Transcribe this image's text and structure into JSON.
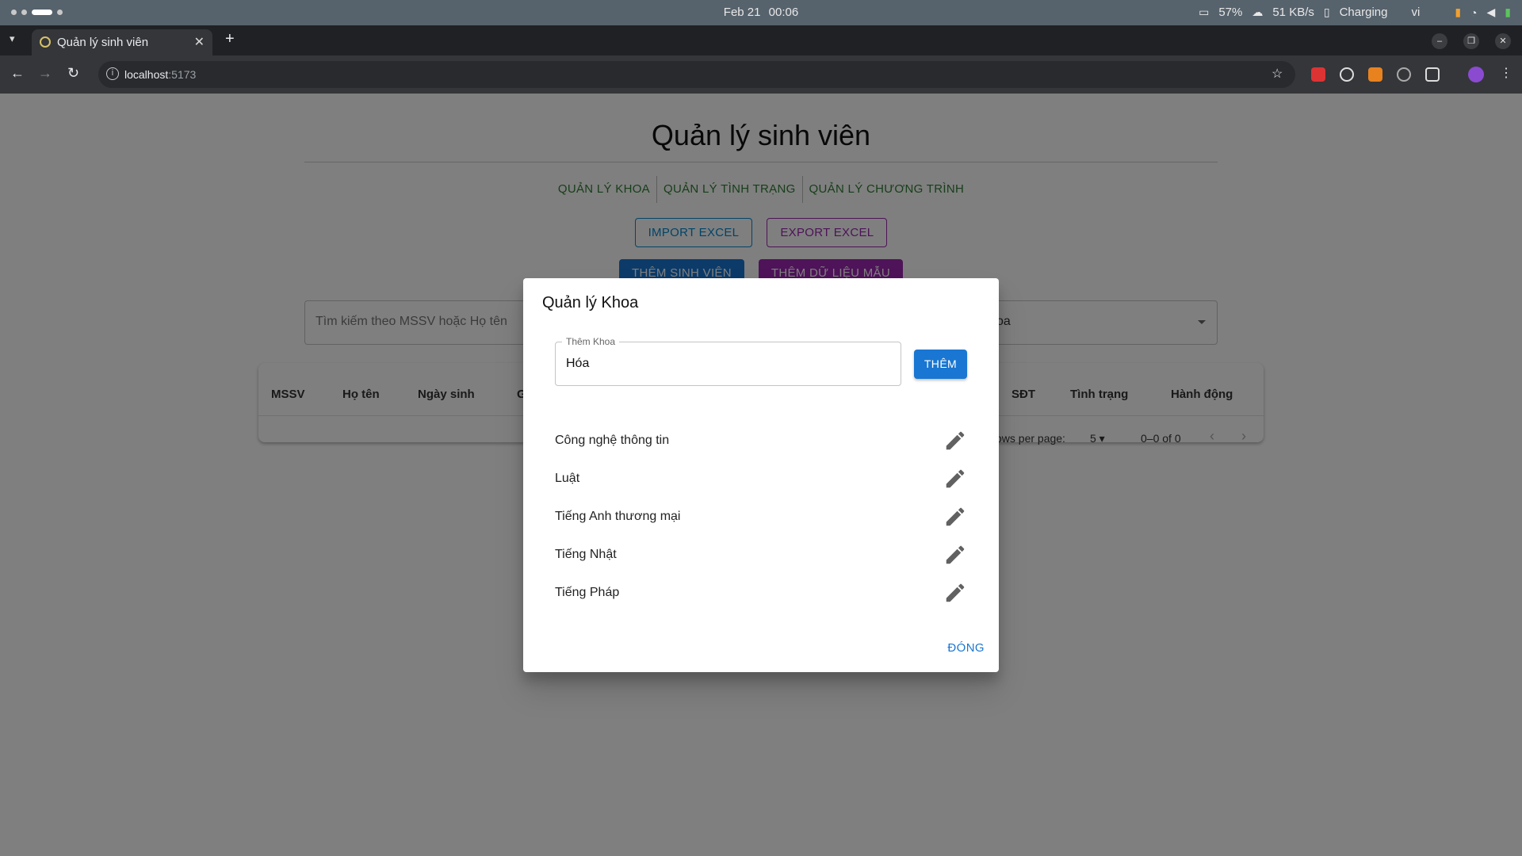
{
  "os": {
    "date": "Feb 21",
    "time": "00:06",
    "battery": "57%",
    "network_speed": "51 KB/s",
    "charging": "Charging",
    "lang": "vi"
  },
  "browser": {
    "tab_title": "Quản lý sinh viên",
    "url_host": "localhost",
    "url_port": ":5173"
  },
  "page": {
    "title": "Quản lý sinh viên",
    "nav": [
      "QUẢN LÝ KHOA",
      "QUẢN LÝ TÌNH TRẠNG",
      "QUẢN LÝ CHƯƠNG TRÌNH"
    ],
    "import_label": "IMPORT EXCEL",
    "export_label": "EXPORT EXCEL",
    "add_student_label": "THÊM SINH VIÊN",
    "add_sample_label": "THÊM DỮ LIỆU MẪU",
    "search_placeholder": "Tìm kiếm theo MSSV hoặc Họ tên",
    "filter_value": "oa",
    "table_headers": [
      "MSSV",
      "Họ tên",
      "Ngày sinh",
      "G",
      "SĐT",
      "Tình trạng",
      "Hành động"
    ],
    "rows_per_page_label": "ows per page:",
    "rows_per_page_value": "5",
    "range": "0–0 of 0"
  },
  "dialog": {
    "title": "Quản lý Khoa",
    "field_label": "Thêm Khoa",
    "field_value": "Hóa",
    "add_label": "THÊM",
    "items": [
      "Công nghệ thông tin",
      "Luật",
      "Tiếng Anh thương mại",
      "Tiếng Nhật",
      "Tiếng Pháp"
    ],
    "close_label": "ĐÓNG"
  }
}
